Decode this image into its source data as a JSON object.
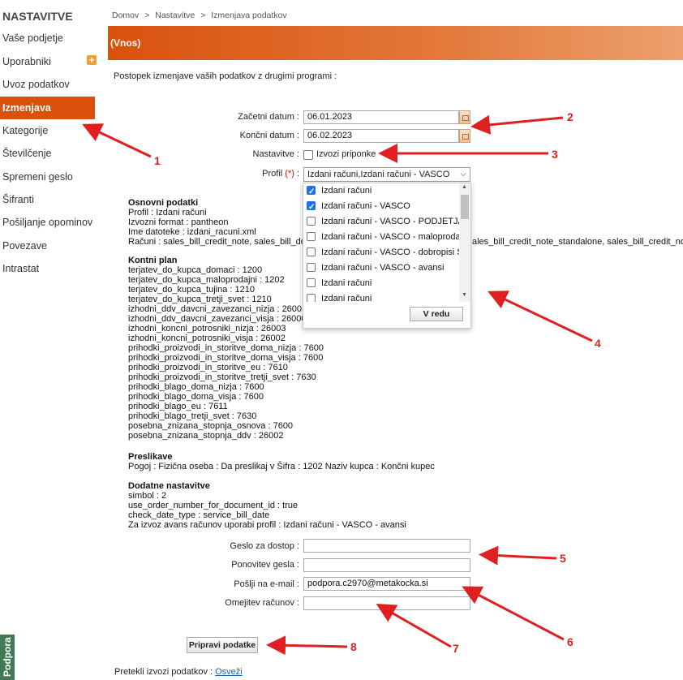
{
  "sidebar": {
    "heading": "NASTAVITVE",
    "items": [
      {
        "label": "Vaše podjetje"
      },
      {
        "label": "Uporabniki"
      },
      {
        "label": "Uvoz podatkov"
      },
      {
        "label": "Izmenjava podatkov"
      },
      {
        "label": "Kategorije"
      },
      {
        "label": "Številčenje"
      },
      {
        "label": "Spremeni geslo"
      },
      {
        "label": "Šifranti"
      },
      {
        "label": "Pošiljanje opominov"
      },
      {
        "label": "Povezave"
      },
      {
        "label": "Intrastat"
      }
    ],
    "support_tab": "Podpora"
  },
  "breadcrumb": [
    "Domov",
    ">",
    "Nastavitve",
    ">",
    "Izmenjava podatkov"
  ],
  "header": {
    "title": "(Vnos)"
  },
  "intro": "Postopek izmenjave vaših podatkov z drugimi programi :",
  "form": {
    "start_date": {
      "label": "Začetni datum :",
      "value": "06.01.2023"
    },
    "end_date": {
      "label": "Končni datum :",
      "value": "06.02.2023"
    },
    "settings": {
      "label": "Nastavitve :",
      "checkbox_label": "Izvozi priponke"
    },
    "profile": {
      "label": "Profil",
      "required": "(*)",
      "colon": ":",
      "value": "Izdani računi,Izdani računi - VASCO"
    }
  },
  "dropdown": {
    "options": [
      {
        "label": "Izdani računi",
        "checked": true
      },
      {
        "label": "Izdani računi - VASCO",
        "checked": true
      },
      {
        "label": "Izdani računi - VASCO - PODJETJA",
        "checked": false
      },
      {
        "label": "Izdani računi - VASCO - maloprodaja",
        "checked": false
      },
      {
        "label": "Izdani računi - VASCO - dobropisi S",
        "checked": false
      },
      {
        "label": "Izdani računi - VASCO - avansi",
        "checked": false
      },
      {
        "label": "Izdani računi",
        "checked": false
      },
      {
        "label": "Izdani računi",
        "checked": false
      }
    ],
    "ok_label": "V redu"
  },
  "info": {
    "basic_title": "Osnovni podatki",
    "basic_lines": [
      "Profil : Izdani računi",
      "Izvozni format : pantheon",
      "Ime datoteke : izdani_racuni.xml"
    ],
    "invoices_line_left": "Računi : sales_bill_credit_note, sales_bill_do",
    "invoices_line_right": "ales_bill_credit_note_standalone, sales_bill_credit_note,",
    "accounts_title": "Kontni plan",
    "accounts_lines": [
      "terjatev_do_kupca_domaci : 1200",
      "terjatev_do_kupca_maloprodajni : 1202",
      "terjatev_do_kupca_tujina : 1210",
      "terjatev_do_kupca_tretji_svet : 1210",
      "izhodni_ddv_davcni_zavezanci_nizja : 26001",
      "izhodni_ddv_davcni_zavezanci_visja : 26000",
      "izhodni_koncni_potrosniki_nizja : 26003",
      "izhodni_koncni_potrosniki_visja : 26002",
      "prihodki_proizvodi_in_storitve_doma_nizja : 7600",
      "prihodki_proizvodi_in_storitve_doma_visja : 7600",
      "prihodki_proizvodi_in_storitve_eu : 7610",
      "prihodki_proizvodi_in_storitve_tretji_svet : 7630",
      "prihodki_blago_doma_nizja : 7600",
      "prihodki_blago_doma_visja : 7600",
      "prihodki_blago_eu : 7611",
      "prihodki_blago_tretji_svet : 7630",
      "posebna_znizana_stopnja_osnova : 7600",
      "posebna_znizana_stopnja_ddv : 26002"
    ],
    "mapping_title": "Preslikave",
    "mapping_line": "Pogoj : Fizična oseba : Da preslikaj v Šifra : 1202 Naziv kupca : Končni kupec",
    "extra_title": "Dodatne nastavitve",
    "extra_lines": [
      "simbol : 2",
      "use_order_number_for_document_id : true",
      "check_date_type : service_bill_date",
      "Za izvoz avans računov uporabi profil : Izdani računi - VASCO - avansi"
    ]
  },
  "form2": {
    "password": {
      "label": "Geslo za dostop :",
      "value": ""
    },
    "password_repeat": {
      "label": "Ponovitev gesla :",
      "value": ""
    },
    "email": {
      "label": "Pošlji na e-mail :",
      "value": "podpora.c2970@metakocka.si"
    },
    "limit": {
      "label": "Omejitev računov :",
      "value": ""
    }
  },
  "prepare_button": "Pripravi podatke",
  "past_exports": {
    "label": "Pretekli izvozi podatkov :",
    "link": "Osveži"
  },
  "annotations": [
    "1",
    "2",
    "3",
    "4",
    "5",
    "6",
    "7",
    "8"
  ],
  "colors": {
    "accent": "#d9510c",
    "arrow": "#e02020"
  }
}
